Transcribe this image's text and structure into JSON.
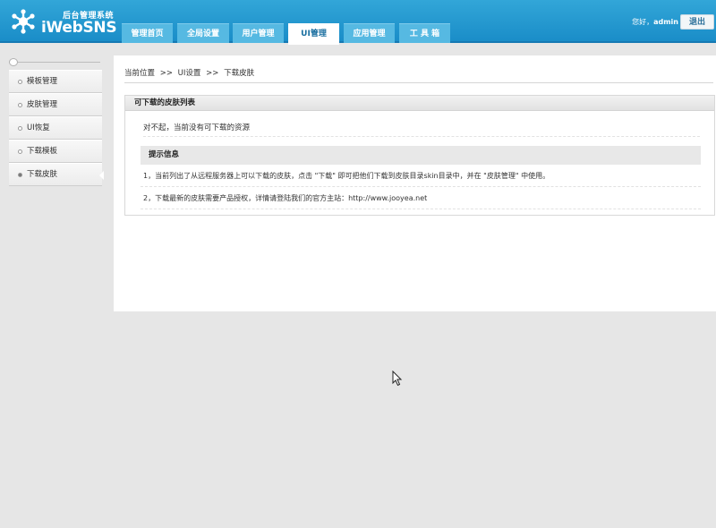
{
  "header": {
    "logo_subtitle": "后台管理系统",
    "logo_name": "iWebSNS",
    "greeting_prefix": "您好，",
    "username": "admin",
    "logout_label": "退出"
  },
  "nav": {
    "tabs": [
      {
        "label": "管理首页"
      },
      {
        "label": "全局设置"
      },
      {
        "label": "用户管理"
      },
      {
        "label": "UI管理",
        "active": true
      },
      {
        "label": "应用管理"
      },
      {
        "label": "工 具 箱"
      }
    ]
  },
  "sidebar": {
    "items": [
      {
        "label": "模板管理"
      },
      {
        "label": "皮肤管理"
      },
      {
        "label": "UI恢复"
      },
      {
        "label": "下载模板"
      },
      {
        "label": "下载皮肤",
        "active": true
      }
    ]
  },
  "breadcrumb": {
    "current_label": "当前位置",
    "sep": ">>",
    "level1": "UI设置",
    "level2": "下载皮肤"
  },
  "panel": {
    "title": "可下载的皮肤列表",
    "notice": "对不起，当前没有可下载的资源"
  },
  "tips": {
    "title": "提示信息",
    "lines": [
      "1，当前列出了从远程服务器上可以下载的皮肤，点击 \"下载\" 即可把他们下载到皮肤目录skin目录中，并在 \"皮肤管理\" 中使用。",
      "2，下载最新的皮肤需要产品授权，详情请登陆我们的官方主站：http://www.jooyea.net"
    ]
  },
  "colors": {
    "header_blue": "#1a8dc8",
    "tab_blue": "#56b9e2",
    "page_bg": "#e6e6e6"
  }
}
